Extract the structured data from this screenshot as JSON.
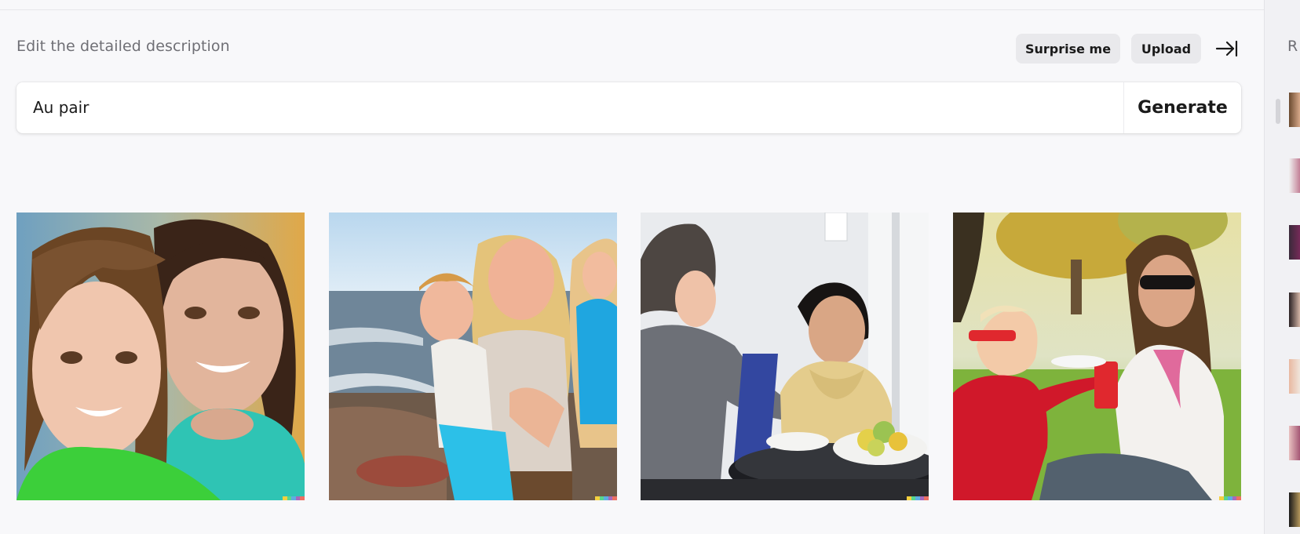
{
  "header": {
    "hint": "Edit the detailed description",
    "surprise_label": "Surprise me",
    "upload_label": "Upload"
  },
  "prompt": {
    "value": "Au pair",
    "generate_label": "Generate"
  },
  "results": [
    {
      "name": "result-image-1",
      "subject": "woman and girl selfie"
    },
    {
      "name": "result-image-2",
      "subject": "woman with two kids on beach"
    },
    {
      "name": "result-image-3",
      "subject": "two women at table"
    },
    {
      "name": "result-image-4",
      "subject": "woman feeding toddler in park"
    }
  ],
  "sidebar": {
    "title": "R"
  },
  "colors": {
    "background": "#f8f8fa",
    "button_bg": "#e9e9ec",
    "signature": [
      "#f4d03f",
      "#58d68d",
      "#5dade2",
      "#a569bd",
      "#ec7063"
    ]
  }
}
